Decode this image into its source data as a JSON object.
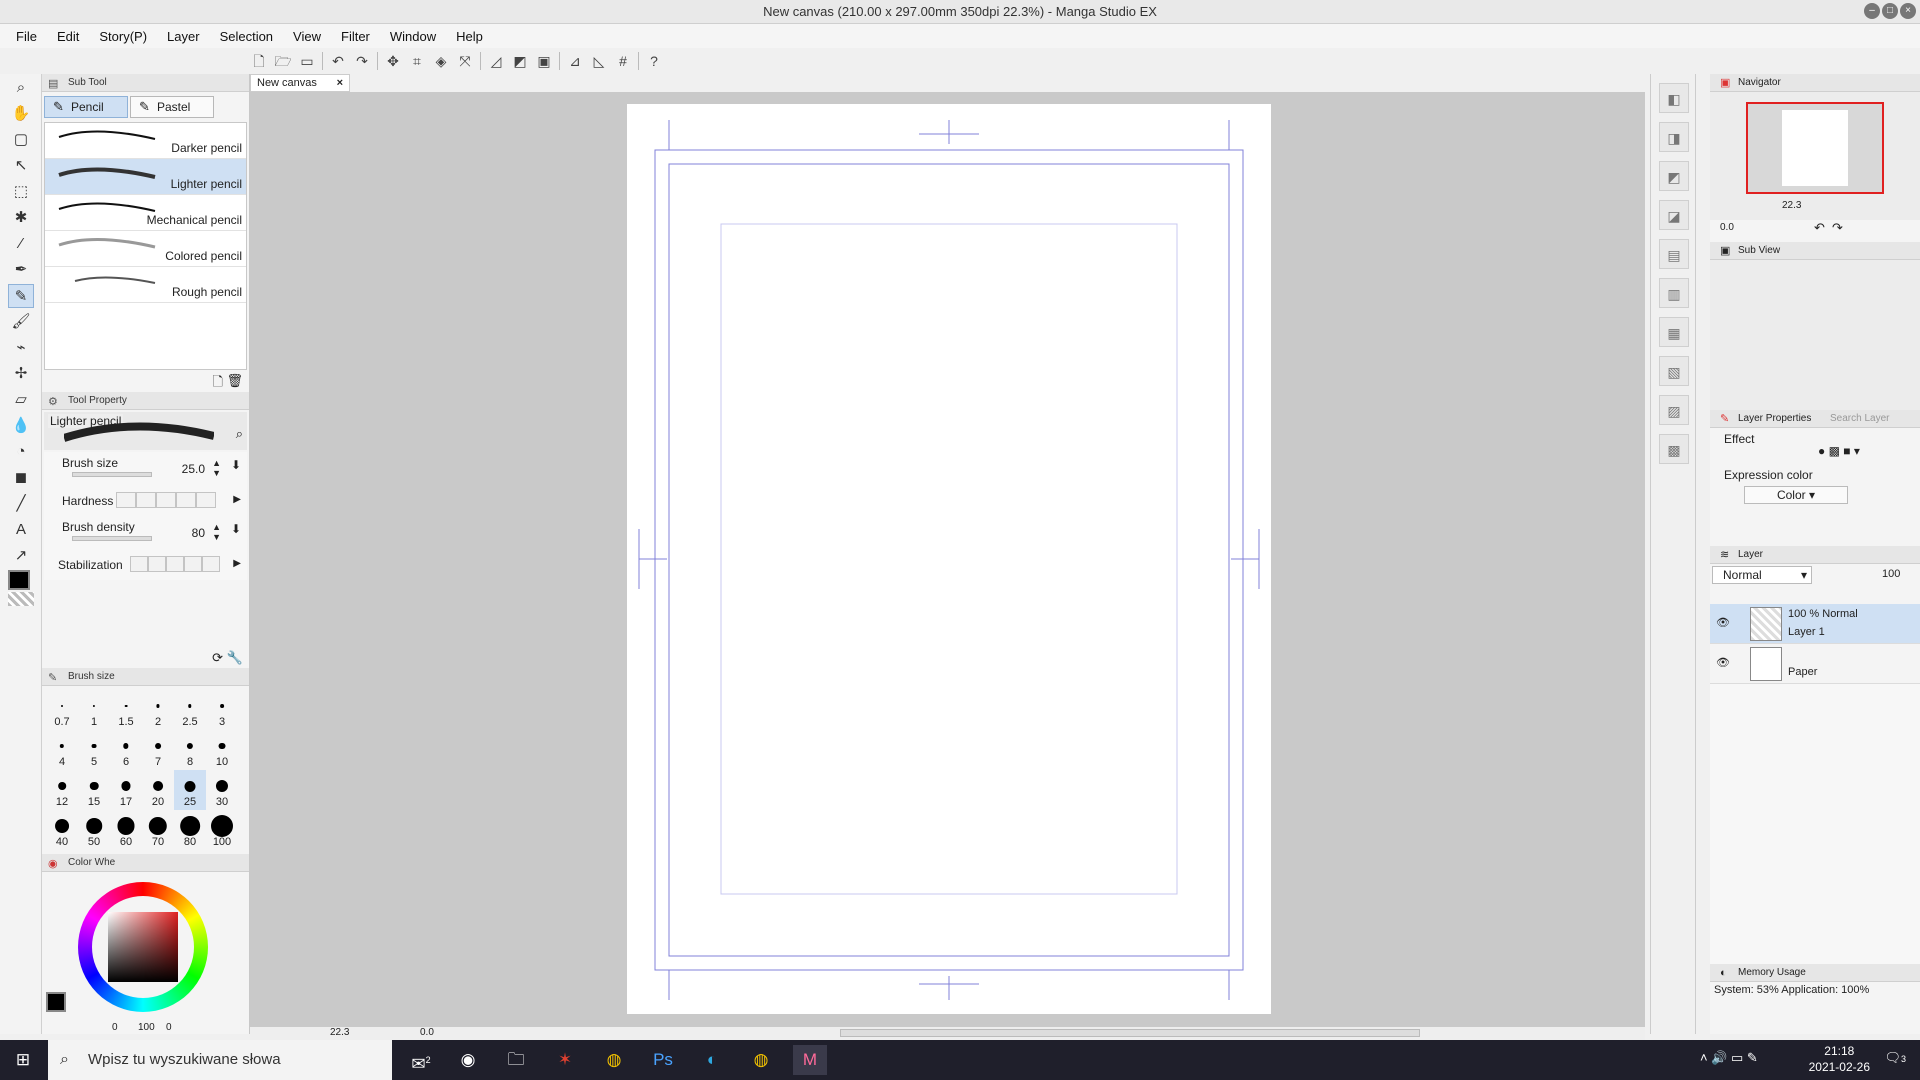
{
  "window": {
    "title": "New canvas (210.00 x 297.00mm 350dpi 22.3%)  - Manga Studio EX"
  },
  "menu": [
    "File",
    "Edit",
    "Story(P)",
    "Layer",
    "Selection",
    "View",
    "Filter",
    "Window",
    "Help"
  ],
  "document_tab": {
    "label": "New canvas"
  },
  "sub_tool": {
    "title": "Sub Tool",
    "tabs": [
      {
        "label": "Pencil",
        "active": true
      },
      {
        "label": "Pastel",
        "active": false
      }
    ],
    "brushes": [
      {
        "label": "Darker pencil"
      },
      {
        "label": "Lighter pencil",
        "active": true
      },
      {
        "label": "Mechanical pencil"
      },
      {
        "label": "Colored pencil"
      },
      {
        "label": "Rough pencil"
      }
    ]
  },
  "tool_property": {
    "title": "Tool Property",
    "preset": "Lighter pencil",
    "brush_size_label": "Brush size",
    "brush_size_value": "25.0",
    "hardness_label": "Hardness",
    "brush_density_label": "Brush density",
    "brush_density_value": "80",
    "stabilization_label": "Stabilization"
  },
  "brush_size_panel": {
    "title": "Brush size",
    "sizes": [
      "0.7",
      "1",
      "1.5",
      "2",
      "2.5",
      "3",
      "4",
      "5",
      "6",
      "7",
      "8",
      "10",
      "12",
      "15",
      "17",
      "20",
      "25",
      "30",
      "40",
      "50",
      "60",
      "70",
      "80",
      "100"
    ],
    "selected": "25"
  },
  "color_wheel": {
    "title": "Color Whe",
    "footer": [
      "0",
      "100",
      "0"
    ],
    "current_color": "#000000"
  },
  "canvas": {
    "zoom": "22.3",
    "rotation": "0.0"
  },
  "navigator": {
    "title": "Navigator",
    "zoom": "22.3",
    "rotation": "0.0"
  },
  "sub_view": {
    "title": "Sub View"
  },
  "layer_properties": {
    "title": "Layer Properties",
    "search_tab": "Search Layer",
    "effect_label": "Effect",
    "expression_color_label": "Expression color",
    "expression_color_value": "Color"
  },
  "layer_panel": {
    "title": "Layer",
    "blend_mode": "Normal",
    "opacity": "100",
    "layers": [
      {
        "info": "100 %  Normal",
        "name": "Layer 1",
        "active": true
      },
      {
        "info": "",
        "name": "Paper",
        "active": false
      }
    ]
  },
  "memory_usage": {
    "title": "Memory Usage",
    "status": "System: 53%   Application: 100%"
  },
  "taskbar": {
    "search_placeholder": "Wpisz tu wyszukiwane słowa",
    "mail_badge": "2",
    "ps_label": "Ps",
    "time": "21:18",
    "date": "2021-02-26",
    "notif_count": "3"
  },
  "colors": {
    "accent": "#cfe0f3",
    "guide": "#8080d8",
    "navigator_frame": "#e02020"
  }
}
